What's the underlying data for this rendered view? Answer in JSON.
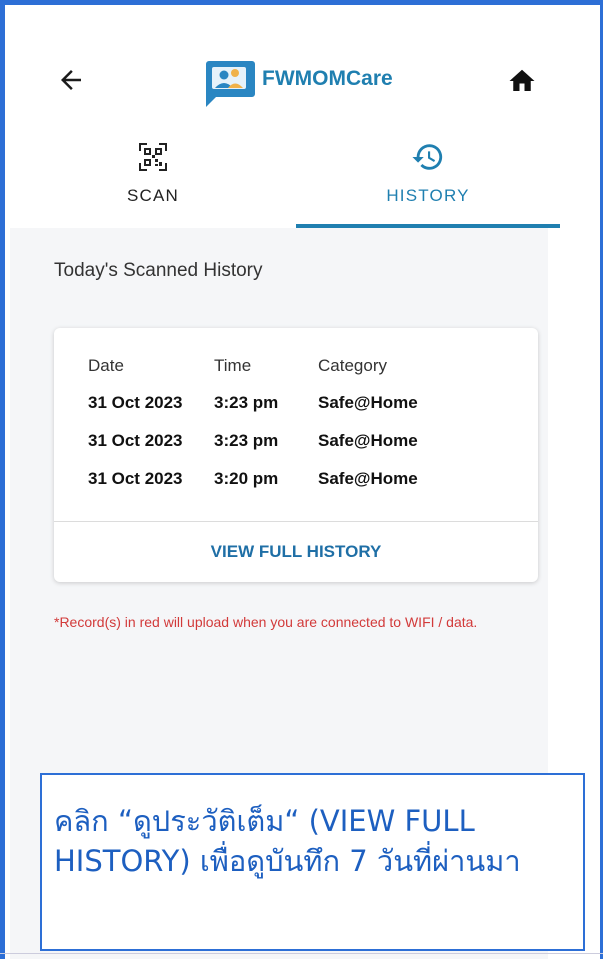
{
  "app": {
    "title": "FWMOMCare"
  },
  "header": {
    "back_icon": "arrow-left-icon",
    "home_icon": "home-icon",
    "logo_icon": "chat-people-logo-icon"
  },
  "tabs": [
    {
      "label": "SCAN",
      "icon": "qr-code-icon",
      "active": false
    },
    {
      "label": "HISTORY",
      "icon": "history-clock-icon",
      "active": true
    }
  ],
  "history": {
    "section_title": "Today's Scanned History",
    "columns": [
      "Date",
      "Time",
      "Category"
    ],
    "rows": [
      [
        "31 Oct 2023",
        "3:23 pm",
        "Safe@Home"
      ],
      [
        "31 Oct 2023",
        "3:23 pm",
        "Safe@Home"
      ],
      [
        "31 Oct 2023",
        "3:20 pm",
        "Safe@Home"
      ]
    ],
    "view_full_label": "VIEW FULL HISTORY"
  },
  "note": "*Record(s) in red will upload when you are connected to WIFI / data.",
  "callout": "คลิก “ดูประวัติเต็ม“ (VIEW FULL HISTORY) เพื่อดูบันทึก 7 วันที่ผ่านมา",
  "colors": {
    "accent": "#1f7fb0",
    "frame_border": "#2d6fd6",
    "note_red": "#d23a3a"
  }
}
